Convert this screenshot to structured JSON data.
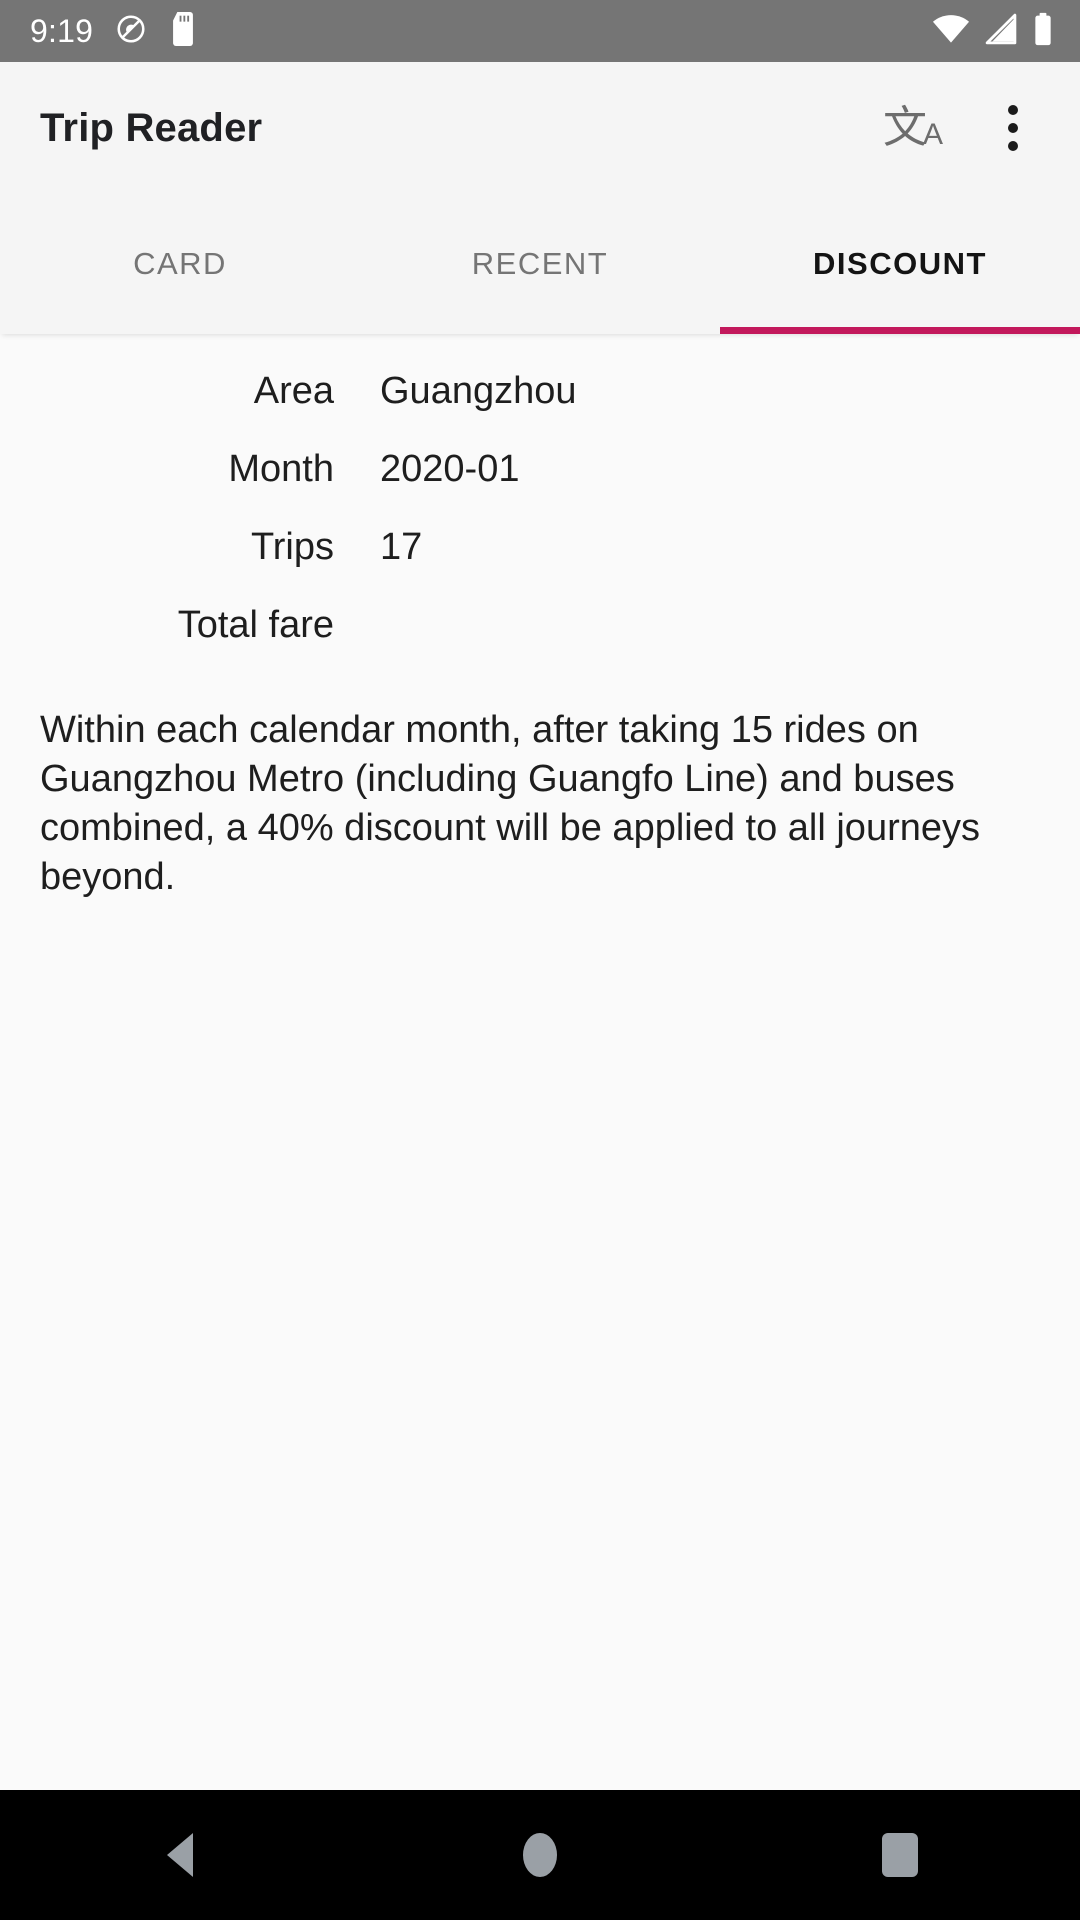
{
  "status_bar": {
    "time": "9:19",
    "icons_left": [
      "do-not-disturb-icon",
      "sd-card-icon"
    ],
    "icons_right": [
      "wifi-icon",
      "cellular-signal-icon",
      "battery-icon"
    ]
  },
  "app_bar": {
    "title": "Trip Reader",
    "translate_glyph": "文",
    "translate_glyph_sub": "A",
    "translate_icon_name": "translate-icon",
    "overflow_icon_name": "overflow-menu-icon"
  },
  "tabs": [
    {
      "label": "CARD",
      "active": false
    },
    {
      "label": "RECENT",
      "active": false
    },
    {
      "label": "DISCOUNT",
      "active": true
    }
  ],
  "details": {
    "rows": [
      {
        "label": "Area",
        "value": "Guangzhou"
      },
      {
        "label": "Month",
        "value": "2020-01"
      },
      {
        "label": "Trips",
        "value": "17"
      },
      {
        "label": "Total fare",
        "value": ""
      }
    ]
  },
  "description": "Within each calendar month, after taking 15 rides on Guangzhou Metro (including Guangfo Line) and buses combined, a 40% discount will be applied to all journeys beyond.",
  "nav_bar": {
    "back_label": "Back",
    "home_label": "Home",
    "recents_label": "Recents"
  },
  "colors": {
    "accent": "#c2185b",
    "status_bar_bg": "#757575",
    "app_bar_bg": "#f5f5f5",
    "content_bg": "#fafafa",
    "nav_bar_bg": "#000000",
    "text_primary": "#1e1e1e",
    "text_secondary": "#757575"
  }
}
